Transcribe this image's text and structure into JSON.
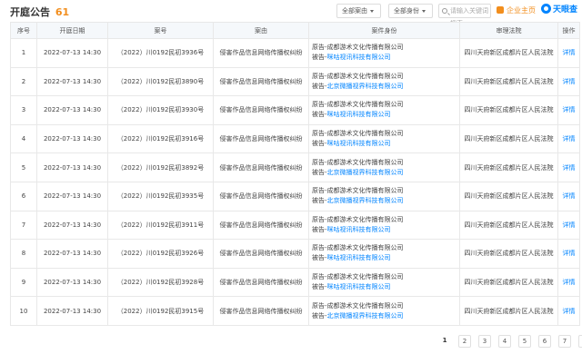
{
  "header": {
    "title": "开庭公告",
    "count": "61",
    "reason_dropdown": "全部案由",
    "role_dropdown": "全部身份",
    "search_placeholder": "请输入关键词搜索",
    "enterprise_link": "企业主页",
    "logo_text": "天眼查"
  },
  "table": {
    "columns": [
      "序号",
      "开庭日期",
      "案号",
      "案由",
      "案件身份",
      "审理法院",
      "操作"
    ],
    "rows": [
      {
        "no": "1",
        "date": "2022-07-13 14:30",
        "case_no": "（2022）川0192民初3936号",
        "reason": "侵害作品信息网络传播权纠纷",
        "plaintiff": "原告-成都游术文化传播有限公司",
        "defendant_label": "被告-",
        "defendant": "咪咕视讯科技有限公司",
        "court": "四川天府新区成都片区人民法院",
        "action": "详情"
      },
      {
        "no": "2",
        "date": "2022-07-13 14:30",
        "case_no": "（2022）川0192民初3890号",
        "reason": "侵害作品信息网络传播权纠纷",
        "plaintiff": "原告-成都游术文化传播有限公司",
        "defendant_label": "被告-",
        "defendant": "北京微播视界科技有限公司",
        "court": "四川天府新区成都片区人民法院",
        "action": "详情"
      },
      {
        "no": "3",
        "date": "2022-07-13 14:30",
        "case_no": "（2022）川0192民初3930号",
        "reason": "侵害作品信息网络传播权纠纷",
        "plaintiff": "原告-成都游术文化传播有限公司",
        "defendant_label": "被告-",
        "defendant": "咪咕视讯科技有限公司",
        "court": "四川天府新区成都片区人民法院",
        "action": "详情"
      },
      {
        "no": "4",
        "date": "2022-07-13 14:30",
        "case_no": "（2022）川0192民初3916号",
        "reason": "侵害作品信息网络传播权纠纷",
        "plaintiff": "原告-成都游术文化传播有限公司",
        "defendant_label": "被告-",
        "defendant": "咪咕视讯科技有限公司",
        "court": "四川天府新区成都片区人民法院",
        "action": "详情"
      },
      {
        "no": "5",
        "date": "2022-07-13 14:30",
        "case_no": "（2022）川0192民初3892号",
        "reason": "侵害作品信息网络传播权纠纷",
        "plaintiff": "原告-成都游术文化传播有限公司",
        "defendant_label": "被告-",
        "defendant": "北京微播视界科技有限公司",
        "court": "四川天府新区成都片区人民法院",
        "action": "详情"
      },
      {
        "no": "6",
        "date": "2022-07-13 14:30",
        "case_no": "（2022）川0192民初3935号",
        "reason": "侵害作品信息网络传播权纠纷",
        "plaintiff": "原告-成都游术文化传播有限公司",
        "defendant_label": "被告-",
        "defendant": "北京微播视界科技有限公司",
        "court": "四川天府新区成都片区人民法院",
        "action": "详情"
      },
      {
        "no": "7",
        "date": "2022-07-13 14:30",
        "case_no": "（2022）川0192民初3911号",
        "reason": "侵害作品信息网络传播权纠纷",
        "plaintiff": "原告-成都游术文化传播有限公司",
        "defendant_label": "被告-",
        "defendant": "咪咕视讯科技有限公司",
        "court": "四川天府新区成都片区人民法院",
        "action": "详情"
      },
      {
        "no": "8",
        "date": "2022-07-13 14:30",
        "case_no": "（2022）川0192民初3926号",
        "reason": "侵害作品信息网络传播权纠纷",
        "plaintiff": "原告-成都游术文化传播有限公司",
        "defendant_label": "被告-",
        "defendant": "咪咕视讯科技有限公司",
        "court": "四川天府新区成都片区人民法院",
        "action": "详情"
      },
      {
        "no": "9",
        "date": "2022-07-13 14:30",
        "case_no": "（2022）川0192民初3928号",
        "reason": "侵害作品信息网络传播权纠纷",
        "plaintiff": "原告-成都游术文化传播有限公司",
        "defendant_label": "被告-",
        "defendant": "咪咕视讯科技有限公司",
        "court": "四川天府新区成都片区人民法院",
        "action": "详情"
      },
      {
        "no": "10",
        "date": "2022-07-13 14:30",
        "case_no": "（2022）川0192民初3915号",
        "reason": "侵害作品信息网络传播权纠纷",
        "plaintiff": "原告-成都游术文化传播有限公司",
        "defendant_label": "被告-",
        "defendant": "北京微播视界科技有限公司",
        "court": "四川天府新区成都片区人民法院",
        "action": "详情"
      }
    ]
  },
  "pagination": {
    "pages": [
      "1",
      "2",
      "3",
      "4",
      "5",
      "6",
      "7"
    ],
    "current": "1",
    "next_icon": "chevron-right-icon"
  },
  "colors": {
    "accent": "#0084ff",
    "count": "#f28e1d",
    "header_bg": "#f5f8fb"
  }
}
